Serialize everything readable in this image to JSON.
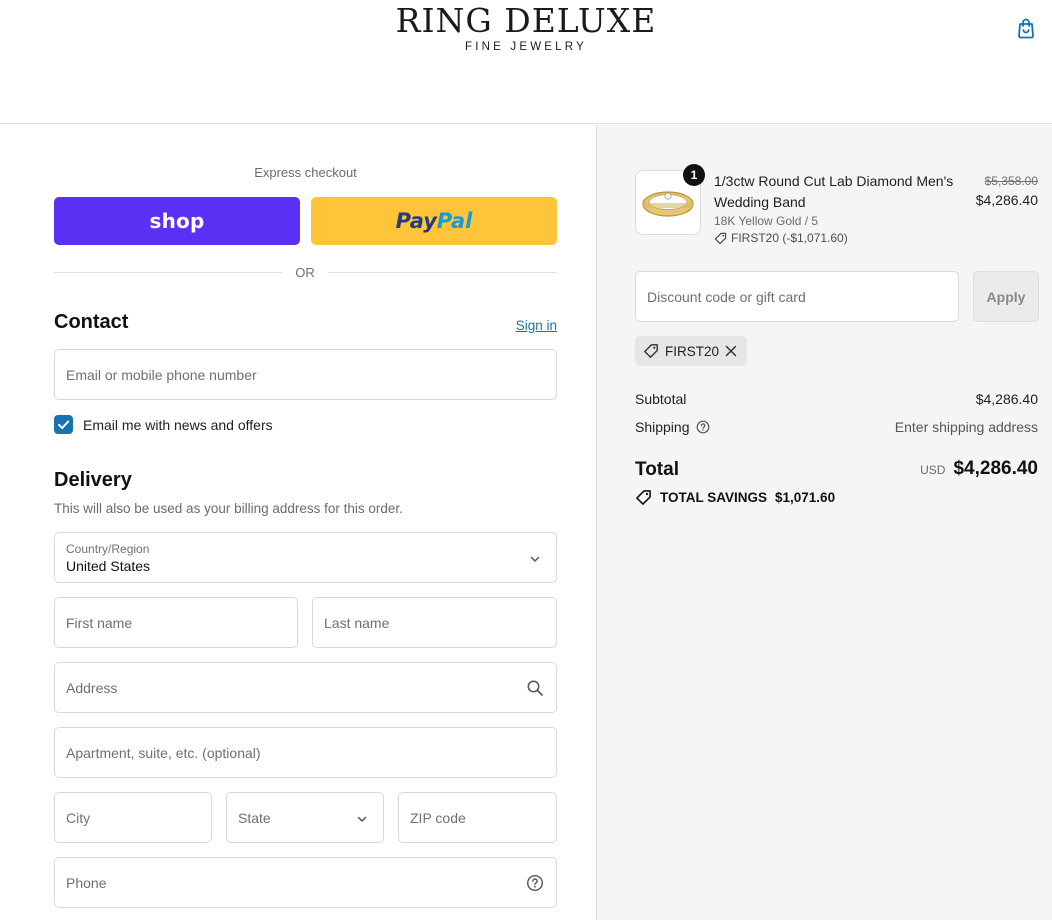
{
  "header": {
    "brand_name": "RING DELUXE",
    "brand_tagline": "FINE JEWELRY",
    "cart_icon": "shopping-bag-icon"
  },
  "express": {
    "label": "Express checkout",
    "shop_label": "shop",
    "paypal_label_1": "Pay",
    "paypal_label_2": "Pal",
    "or_label": "OR"
  },
  "contact": {
    "heading": "Contact",
    "sign_in": "Sign in",
    "email_placeholder": "Email or mobile phone number",
    "newsletter_label": "Email me with news and offers",
    "newsletter_checked": true
  },
  "delivery": {
    "heading": "Delivery",
    "subtitle": "This will also be used as your billing address for this order.",
    "country_label": "Country/Region",
    "country_value": "United States",
    "first_name_placeholder": "First name",
    "last_name_placeholder": "Last name",
    "address_placeholder": "Address",
    "apartment_placeholder": "Apartment, suite, etc. (optional)",
    "city_placeholder": "City",
    "state_placeholder": "State",
    "zip_placeholder": "ZIP code",
    "phone_placeholder": "Phone"
  },
  "order": {
    "quantity": "1",
    "product_name": "1/3ctw Round Cut Lab Diamond Men's Wedding Band",
    "variant": "18K Yellow Gold / 5",
    "applied_discount": "FIRST20 (-$1,071.60)",
    "original_price": "$5,358.00",
    "price": "$4,286.40",
    "discount_placeholder": "Discount code or gift card",
    "apply_label": "Apply",
    "discount_chip": "FIRST20"
  },
  "summary": {
    "subtotal_label": "Subtotal",
    "subtotal_value": "$4,286.40",
    "shipping_label": "Shipping",
    "shipping_value": "Enter shipping address",
    "total_label": "Total",
    "currency": "USD",
    "total_value": "$4,286.40",
    "savings_label": "TOTAL SAVINGS",
    "savings_value": "$1,071.60"
  },
  "colors": {
    "shop_purple": "#5a31f4",
    "paypal_yellow": "#ffc43a",
    "link_blue": "#1773b0",
    "summary_bg": "#f5f5f5"
  }
}
